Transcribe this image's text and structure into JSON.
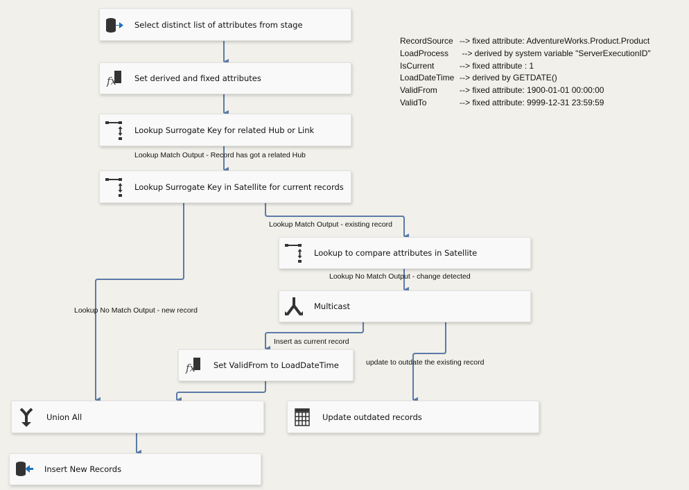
{
  "components": [
    {
      "label": "Select distinct list of attributes from stage",
      "icon": "ole-db-source-icon"
    },
    {
      "label": "Set derived and fixed attributes",
      "icon": "derived-column-icon"
    },
    {
      "label": "Lookup Surrogate Key for related Hub or Link",
      "icon": "lookup-icon"
    },
    {
      "label": "Lookup Surrogate Key in Satellite for current records",
      "icon": "lookup-icon"
    },
    {
      "label": "Lookup to compare attributes in Satellite",
      "icon": "lookup-icon"
    },
    {
      "label": "Multicast",
      "icon": "multicast-icon"
    },
    {
      "label": "Set ValidFrom to LoadDateTime",
      "icon": "derived-column-icon"
    },
    {
      "label": "Union All",
      "icon": "union-all-icon"
    },
    {
      "label": "Update outdated records",
      "icon": "ole-db-command-icon"
    },
    {
      "label": "Insert New Records",
      "icon": "ole-db-destination-icon"
    }
  ],
  "paths": [
    "Lookup Match Output - Record has got a related Hub",
    "Lookup Match Output - existing record",
    "Lookup No Match Output - change detected",
    "Lookup No Match Output - new record",
    "Insert as current record",
    "update to outdate the existing record"
  ],
  "notes": [
    {
      "key": "RecordSource",
      "value": "--> fixed attribute: AdventureWorks.Product.Product"
    },
    {
      "key": "LoadProcess",
      "value": " --> derived by system variable \"ServerExecutionID\""
    },
    {
      "key": "IsCurrent",
      "value": "--> fixed attribute : 1"
    },
    {
      "key": "LoadDateTime",
      "value": "--> derived by GETDATE()"
    },
    {
      "key": "ValidFrom",
      "value": "--> fixed attribute: 1900-01-01 00:00:00"
    },
    {
      "key": "ValidTo",
      "value": "--> fixed attribute: 9999-12-31 23:59:59"
    }
  ],
  "colors": {
    "connector": "#5b7aa8",
    "background": "#f1f0ea",
    "box": "#f9f9f9"
  }
}
